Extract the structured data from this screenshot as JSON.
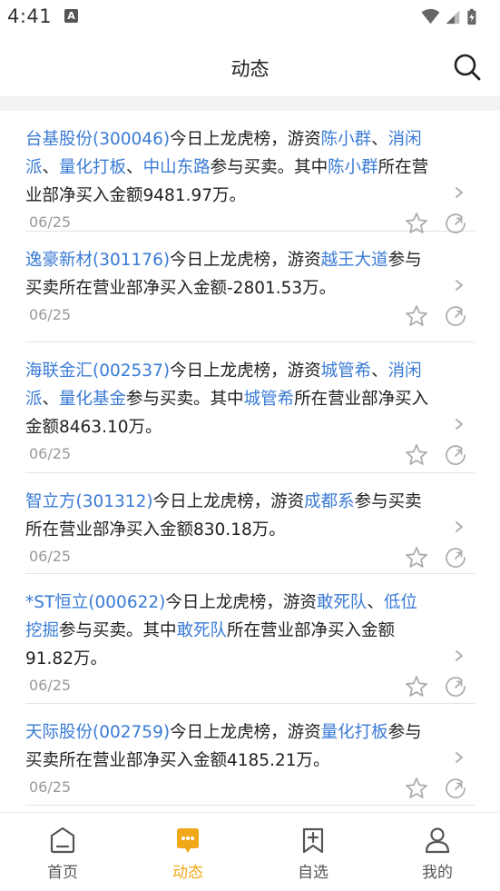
{
  "status": {
    "time": "4:41",
    "notification_glyph": "A"
  },
  "header": {
    "title": "动态"
  },
  "feed": [
    {
      "segments": [
        {
          "t": "台基股份(300046)",
          "link": true
        },
        {
          "t": "今日上龙虎榜，游资",
          "link": false
        },
        {
          "t": "陈小群",
          "link": true
        },
        {
          "t": "、",
          "link": false
        },
        {
          "t": "消闲派",
          "link": true
        },
        {
          "t": "、",
          "link": false
        },
        {
          "t": "量化打板",
          "link": true
        },
        {
          "t": "、",
          "link": false
        },
        {
          "t": "中山东路",
          "link": true
        },
        {
          "t": "参与买卖。其中",
          "link": false
        },
        {
          "t": "陈小群",
          "link": true
        },
        {
          "t": "所在营业部净买入金额9481.97万。",
          "link": false
        }
      ],
      "date": "06/25"
    },
    {
      "segments": [
        {
          "t": "逸豪新材(301176)",
          "link": true
        },
        {
          "t": "今日上龙虎榜，游资",
          "link": false
        },
        {
          "t": "越王大道",
          "link": true
        },
        {
          "t": "参与买卖所在营业部净买入金额-2801.53万。",
          "link": false
        }
      ],
      "date": "06/25"
    },
    {
      "segments": [
        {
          "t": "海联金汇(002537)",
          "link": true
        },
        {
          "t": "今日上龙虎榜，游资",
          "link": false
        },
        {
          "t": "城管希",
          "link": true
        },
        {
          "t": "、",
          "link": false
        },
        {
          "t": "消闲派",
          "link": true
        },
        {
          "t": "、",
          "link": false
        },
        {
          "t": "量化基金",
          "link": true
        },
        {
          "t": "参与买卖。其中",
          "link": false
        },
        {
          "t": "城管希",
          "link": true
        },
        {
          "t": "所在营业部净买入金额8463.10万。",
          "link": false
        }
      ],
      "date": "06/25"
    },
    {
      "segments": [
        {
          "t": "智立方(301312)",
          "link": true
        },
        {
          "t": "今日上龙虎榜，游资",
          "link": false
        },
        {
          "t": "成都系",
          "link": true
        },
        {
          "t": "参与买卖所在营业部净买入金额830.18万。",
          "link": false
        }
      ],
      "date": "06/25"
    },
    {
      "segments": [
        {
          "t": "*ST恒立(000622)",
          "link": true
        },
        {
          "t": "今日上龙虎榜，游资",
          "link": false
        },
        {
          "t": "敢死队",
          "link": true
        },
        {
          "t": "、",
          "link": false
        },
        {
          "t": "低位挖掘",
          "link": true
        },
        {
          "t": "参与买卖。其中",
          "link": false
        },
        {
          "t": "敢死队",
          "link": true
        },
        {
          "t": "所在营业部净买入金额91.82万。",
          "link": false
        }
      ],
      "date": "06/25"
    },
    {
      "segments": [
        {
          "t": "天际股份(002759)",
          "link": true
        },
        {
          "t": "今日上龙虎榜，游资",
          "link": false
        },
        {
          "t": "量化打板",
          "link": true
        },
        {
          "t": "参与买卖所在营业部净买入金额4185.21万。",
          "link": false
        }
      ],
      "date": "06/25"
    }
  ],
  "tabs": [
    {
      "label": "首页",
      "icon": "home-icon",
      "active": false
    },
    {
      "label": "动态",
      "icon": "chat-bubble-icon",
      "active": true
    },
    {
      "label": "自选",
      "icon": "add-watchlist-icon",
      "active": false
    },
    {
      "label": "我的",
      "icon": "profile-icon",
      "active": false
    }
  ],
  "colors": {
    "link": "#3a7bd5",
    "accent": "#f0a818",
    "muted": "#999999"
  }
}
